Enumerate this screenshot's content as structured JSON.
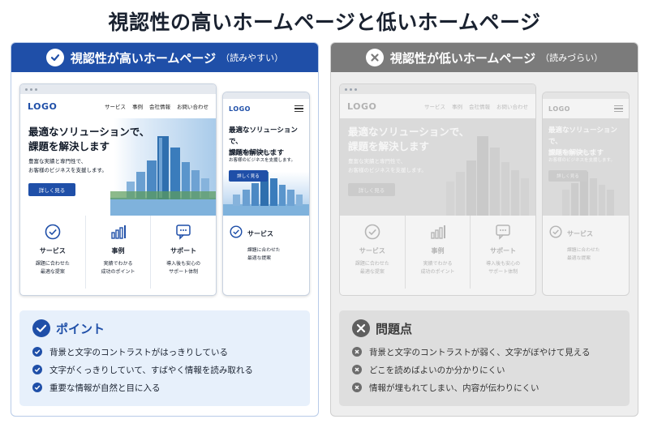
{
  "title": "視認性の高いホームページと低いホームページ",
  "colors": {
    "accent_blue": "#1f4fa8",
    "muted_gray": "#7b7b7b"
  },
  "good": {
    "header_title": "視認性が高いホームページ",
    "header_note": "（読みやすい）",
    "header_icon": "check-circle-icon",
    "desktop": {
      "logo": "LOGO",
      "nav": [
        "サービス",
        "事例",
        "会社情報",
        "お問い合わせ"
      ],
      "hero_line1": "最適なソリューションで、",
      "hero_line2": "課題を解決します",
      "hero_sub1": "豊富な実績と専門性で、",
      "hero_sub2": "お客様のビジネスを支援します。",
      "cta": "詳しく見る",
      "cards": [
        {
          "icon": "check-circle-icon",
          "title": "サービス",
          "desc1": "課題に合わせた",
          "desc2": "最適な提案"
        },
        {
          "icon": "bar-chart-icon",
          "title": "事例",
          "desc1": "実績でわかる",
          "desc2": "成功のポイント"
        },
        {
          "icon": "support-chat-icon",
          "title": "サポート",
          "desc1": "導入後も安心の",
          "desc2": "サポート体制"
        }
      ]
    },
    "mobile": {
      "logo": "LOGO",
      "hero_line1": "最適なソリューションで、",
      "hero_line2": "課題を解決します",
      "hero_sub1": "豊富な実績と専門性で、",
      "hero_sub2": "お客様のビジネスを支援します。",
      "cta": "詳しく見る",
      "card_title": "サービス",
      "card_desc1": "課題に合わせた",
      "card_desc2": "最適な提案"
    },
    "box_title": "ポイント",
    "points": [
      "背景と文字のコントラストがはっきりしている",
      "文字がくっきりしていて、すばやく情報を読み取れる",
      "重要な情報が自然と目に入る"
    ]
  },
  "bad": {
    "header_title": "視認性が低いホームページ",
    "header_note": "（読みづらい）",
    "header_icon": "x-circle-icon",
    "desktop": {
      "logo": "LOGO",
      "nav": [
        "サービス",
        "事例",
        "会社情報",
        "お問い合わせ"
      ],
      "hero_line1": "最適なソリューションで、",
      "hero_line2": "課題を解決します",
      "hero_sub1": "豊富な実績と専門性で、",
      "hero_sub2": "お客様のビジネスを支援します。",
      "cta": "詳しく見る",
      "cards": [
        {
          "icon": "check-circle-icon",
          "title": "サービス",
          "desc1": "課題に合わせた",
          "desc2": "最適な提案"
        },
        {
          "icon": "bar-chart-icon",
          "title": "事例",
          "desc1": "実績でわかる",
          "desc2": "成功のポイント"
        },
        {
          "icon": "support-chat-icon",
          "title": "サポート",
          "desc1": "導入後も安心の",
          "desc2": "サポート体制"
        }
      ]
    },
    "mobile": {
      "logo": "LOGO",
      "hero_line1": "最適なソリューションで、",
      "hero_line2": "課題を解決します",
      "hero_sub1": "豊富な実績と専門性で、",
      "hero_sub2": "お客様のビジネスを支援します。",
      "cta": "詳しく見る",
      "card_title": "サービス",
      "card_desc1": "課題に合わせた",
      "card_desc2": "最適な提案"
    },
    "box_title": "問題点",
    "points": [
      "背景と文字のコントラストが弱く、文字がぼやけて見える",
      "どこを読めばよいのか分かりにくい",
      "情報が埋もれてしまい、内容が伝わりにくい"
    ]
  }
}
